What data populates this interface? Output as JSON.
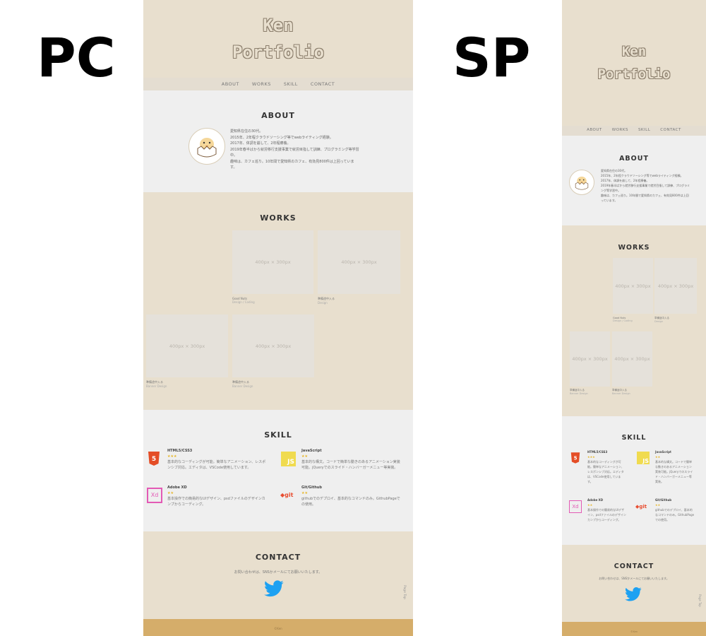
{
  "labels": {
    "pc": "PC",
    "sp": "SP"
  },
  "hero": {
    "line1": "Ken",
    "line2": "Portfolio"
  },
  "nav": {
    "about": "ABOUT",
    "works": "WORKS",
    "skill": "SKILL",
    "contact": "CONTACT"
  },
  "about": {
    "heading": "ABOUT",
    "avatar_label": "Ken@ポートフォリオ",
    "lines_pc": [
      "愛知県在住の30代。",
      "2015年、2年程クラウドソーシング等でwebライティング経験。",
      "2017年、体調を崩して、2年程療養。",
      "2019年春半ばから就労移行支援事業で就労目指して訓練、プログラミング等学習",
      "中。",
      "趣味は、カフェ巡り。10年間で愛知県のカフェ、有効見800件は上回っていま",
      "す。"
    ],
    "lines_sp": [
      "愛知県在住の30代。",
      "2015年、2年程クラウドソーシング等でwebライティング経験。",
      "2017年、体調を崩して、2年程療養。",
      "2019年春半ばから就労移行支援事業で就労目指して訓練、プログラミ",
      "ング等学習中。",
      "趣味は、カフェ巡り。10年間で愛知県のカフェ、有効見800件は上回",
      "っています。"
    ]
  },
  "works": {
    "heading": "WORKS",
    "placeholder": "400px × 300px",
    "items": [
      {
        "title": "Good Nuts",
        "sub": "Design / Coding"
      },
      {
        "title": "準備途中入る",
        "sub": "Design"
      },
      {
        "title": "準備途中入る",
        "sub": "Banner Design"
      },
      {
        "title": "準備途中入る",
        "sub": "Banner Design"
      }
    ]
  },
  "skill": {
    "heading": "SKILL",
    "items": [
      {
        "name": "HTML5/CSS3",
        "stars": "★★★",
        "icon": "html5-icon",
        "color": "#e44d26",
        "desc_pc": [
          "基本的なコーディングが可能。簡単なアニメーション、レスポ",
          "ンシブ対応。エディタは、VSCode使用しています。"
        ],
        "desc_sp": [
          "基本的なコーディングが可",
          "能。簡単なアニメーション、",
          "レスポンシブ対応。エディタ",
          "は、VSCode使用していま",
          "す。"
        ]
      },
      {
        "name": "JavaScript",
        "stars": "★★",
        "icon": "js-icon",
        "color": "#f0db4f",
        "desc_pc": [
          "基本的な構文。コードで簡単な動きのあるアニメーション実装",
          "可能。jQueryでのスライド・ハンバーガーメニュー等実装。"
        ],
        "desc_sp": [
          "基本的な構文。コードで簡単",
          "な動きのあるアニメーション",
          "実装可能。jQueryでのスライ",
          "ド・ハンバーガーメニュー等",
          "実装。"
        ]
      },
      {
        "name": "Adobe XD",
        "stars": "★★",
        "icon": "xd-icon",
        "color": "#e35ab5",
        "desc_pc": [
          "基本操作での簡易的なUIデザイン、psdファイルのデザインカ",
          "ンプからコーディング。"
        ],
        "desc_sp": [
          "基本操作での簡易的なUIデザ",
          "イン、psdファイルのデザイン",
          "カンプからコーディング。"
        ]
      },
      {
        "name": "Git/Github",
        "stars": "★★",
        "icon": "git-icon",
        "color": "#e84e31",
        "desc_pc": [
          "githubでのデプロイ、基本的なコマンドのみ。GithubPageで",
          "の使用。"
        ],
        "desc_sp": [
          "githubでのデプロイ、基本的",
          "なコマンドのみ。GithubPage",
          "での使用。"
        ]
      }
    ]
  },
  "contact": {
    "heading": "CONTACT",
    "text": "お問い合わせは、SNSかメールにてお願いいたします。"
  },
  "footer": {
    "copyright": "©Ken",
    "pagetop": "Page Top"
  },
  "colors": {
    "beige": "#e8dfce",
    "gray": "#efefef",
    "footer": "#d5ad6a",
    "twitter": "#1da1f2"
  }
}
